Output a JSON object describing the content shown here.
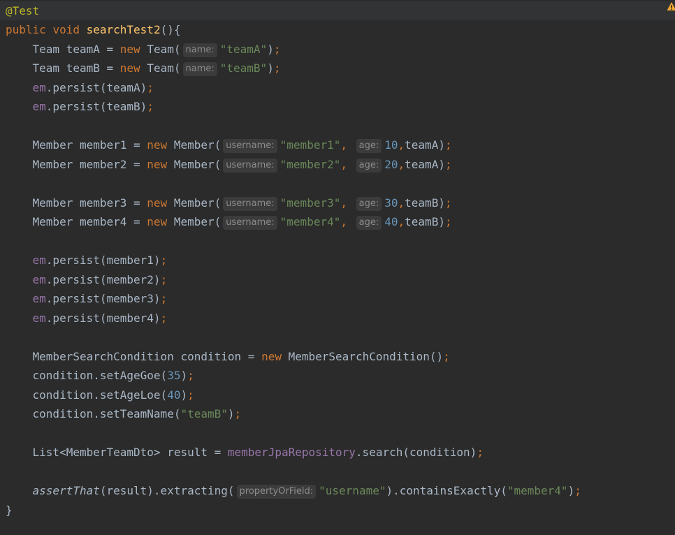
{
  "code": {
    "annotation": "@Test",
    "kw_public": "public",
    "kw_void": "void",
    "kw_new": "new",
    "method_name": "searchTest2",
    "team_a_name": "teamA",
    "team_b_name": "teamB",
    "team_a_str": "\"teamA\"",
    "team_b_str": "\"teamB\"",
    "hint_name": "name:",
    "hint_username": "username:",
    "hint_age": "age:",
    "hint_property": "propertyOrField:",
    "type_team": "Team",
    "type_member": "Member",
    "type_condition": "MemberSearchCondition",
    "em": "em",
    "m1_str": "\"member1\"",
    "m2_str": "\"member2\"",
    "m3_str": "\"member3\"",
    "m4_str": "\"member4\"",
    "age1": "10",
    "age2": "20",
    "age3": "30",
    "age4": "40",
    "age_goe": "35",
    "age_loe": "40",
    "repo_field": "memberJpaRepository",
    "assert_fn": "assertThat",
    "username_str": "\"username\"",
    "expected_str": "\"member4\""
  },
  "colors": {
    "background": "#2b2b2b",
    "keyword": "#cc7832",
    "string": "#6a8759",
    "number": "#6897bb",
    "field": "#9876aa",
    "annotation": "#bbb529",
    "method": "#ffc66d",
    "warning": "#f0a732"
  },
  "icons": {
    "inspection": "warning-icon"
  }
}
